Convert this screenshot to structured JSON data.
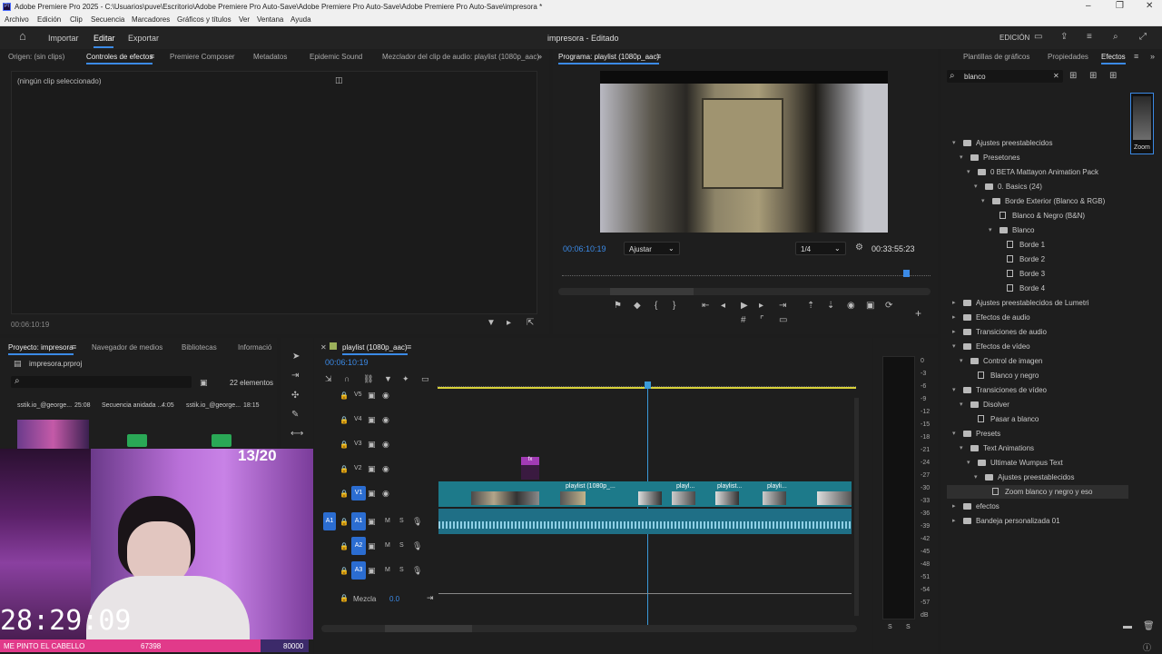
{
  "titlebar": {
    "title": "Adobe Premiere Pro 2025 - C:\\Usuarios\\puve\\Escritorio\\Adobe Premiere Pro Auto-Save\\Adobe Premiere Pro Auto-Save\\Adobe Premiere Pro Auto-Save\\impresora *",
    "app_icon": "Pr"
  },
  "menu": [
    "Archivo",
    "Edición",
    "Clip",
    "Secuencia",
    "Marcadores",
    "Gráficos y títulos",
    "Ver",
    "Ventana",
    "Ayuda"
  ],
  "header": {
    "import": "Importar",
    "edit": "Editar",
    "export": "Exportar",
    "project_title": "impresora - Editado",
    "workspace": "EDICIÓN"
  },
  "source_panel": {
    "tabs": [
      "Origen: (sin clips)",
      "Controles de efectos",
      "Premiere Composer",
      "Metadatos",
      "Epidemic Sound",
      "Mezclador del clip de audio: playlist (1080p_aac)"
    ],
    "empty_msg": "(ningún clip seleccionado)",
    "timecode": "00:06:10:19"
  },
  "program": {
    "tab": "Programa: playlist (1080p_aac)",
    "timecode": "00:06:10:19",
    "fit": "Ajustar",
    "ratio": "1/4",
    "duration": "00:33:55:23"
  },
  "effects_panel": {
    "tabs": [
      "Plantillas de gráficos",
      "Propiedades",
      "Efectos"
    ],
    "search": "blanco",
    "thumb_label": "Zoom",
    "tree": [
      {
        "label": "Ajustes preestablecidos",
        "level": 0,
        "kind": "folder",
        "open": true
      },
      {
        "label": "Presetones",
        "level": 1,
        "kind": "folder",
        "open": true
      },
      {
        "label": "0 BETA Mattayon Animation Pack",
        "level": 2,
        "kind": "folder",
        "open": true
      },
      {
        "label": "0. Basics (24)",
        "level": 3,
        "kind": "folder",
        "open": true
      },
      {
        "label": "Borde Exterior (Blanco & RGB)",
        "level": 4,
        "kind": "folder",
        "open": true
      },
      {
        "label": "Blanco & Negro (B&N)",
        "level": 5,
        "kind": "preset"
      },
      {
        "label": "Blanco",
        "level": 5,
        "kind": "folder",
        "open": true
      },
      {
        "label": "Borde 1",
        "level": 6,
        "kind": "preset"
      },
      {
        "label": "Borde 2",
        "level": 6,
        "kind": "preset"
      },
      {
        "label": "Borde 3",
        "level": 6,
        "kind": "preset"
      },
      {
        "label": "Borde 4",
        "level": 6,
        "kind": "preset"
      },
      {
        "label": "Ajustes preestablecidos de Lumetri",
        "level": 0,
        "kind": "folder",
        "open": false
      },
      {
        "label": "Efectos de audio",
        "level": 0,
        "kind": "folder",
        "open": false
      },
      {
        "label": "Transiciones de audio",
        "level": 0,
        "kind": "folder",
        "open": false
      },
      {
        "label": "Efectos de vídeo",
        "level": 0,
        "kind": "folder",
        "open": true
      },
      {
        "label": "Control de imagen",
        "level": 1,
        "kind": "folder",
        "open": true
      },
      {
        "label": "Blanco y negro",
        "level": 2,
        "kind": "effect"
      },
      {
        "label": "Transiciones de vídeo",
        "level": 0,
        "kind": "folder",
        "open": true
      },
      {
        "label": "Disolver",
        "level": 1,
        "kind": "folder",
        "open": true
      },
      {
        "label": "Pasar a blanco",
        "level": 2,
        "kind": "effect"
      },
      {
        "label": "Presets",
        "level": 0,
        "kind": "folder",
        "open": true
      },
      {
        "label": "Text Animations",
        "level": 1,
        "kind": "folder",
        "open": true
      },
      {
        "label": "Ultimate Wumpus Text",
        "level": 2,
        "kind": "folder",
        "open": true
      },
      {
        "label": "Ajustes preestablecidos",
        "level": 3,
        "kind": "folder",
        "open": true
      },
      {
        "label": "Zoom blanco y negro y eso",
        "level": 4,
        "kind": "preset",
        "selected": true
      },
      {
        "label": "efectos",
        "level": 0,
        "kind": "folder",
        "open": false
      },
      {
        "label": "Bandeja personalizada 01",
        "level": 0,
        "kind": "folder",
        "open": false
      }
    ]
  },
  "project": {
    "tabs": [
      "Proyecto: impresora",
      "Navegador de medios",
      "Bibliotecas",
      "Informació"
    ],
    "file": "impresora.prproj",
    "count": "22 elementos",
    "items": [
      {
        "name": "sstik.io_@george...",
        "dur": "25:08"
      },
      {
        "name": "Secuencia anidada ...",
        "dur": "4:05"
      },
      {
        "name": "sstik.io_@george...",
        "dur": "18:15"
      }
    ]
  },
  "timeline": {
    "tab": "playlist (1080p_aac)",
    "timecode": "00:06:10:19",
    "video_tracks": [
      "V5",
      "V4",
      "V3",
      "V2",
      "V1"
    ],
    "audio_tracks": [
      "A1",
      "A2",
      "A3"
    ],
    "src_audio": "A1",
    "mix_label": "Mezcla",
    "mix_value": "0.0",
    "clip_labels": [
      "playlist (1080p_...",
      "playl...",
      "playlist...",
      "playli..."
    ],
    "fx": "fx"
  },
  "meter": {
    "scale": [
      "0",
      "-3",
      "-6",
      "-9",
      "-12",
      "-15",
      "-18",
      "-21",
      "-24",
      "-27",
      "-30",
      "-33",
      "-36",
      "-39",
      "-42",
      "-45",
      "-48",
      "-51",
      "-54",
      "-57",
      "dB"
    ],
    "s_labels": [
      "S",
      "S"
    ]
  },
  "overlay": {
    "counter": "13/20",
    "clock": "28:29:09",
    "goal_text": "ME PINTO EL CABELLO",
    "goal_current": "67398",
    "goal_target": "80000"
  },
  "colors": {
    "accent": "#3b8ae6",
    "clip_video": "#1d7a8a",
    "clip_audio": "#1f6f86",
    "playhead": "#3a9ad9",
    "goal_bar": "#e13a8a"
  }
}
